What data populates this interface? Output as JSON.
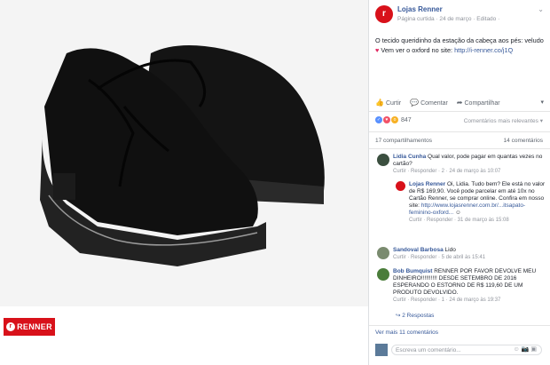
{
  "brand_color": "#d8111a",
  "link_color": "#365899",
  "photo": {
    "logo_text": "RENNER"
  },
  "post": {
    "page_name": "Lojas Renner",
    "meta": "Página curtida · 24 de março · Editado ·",
    "text_1": "O tecido queridinho da estação da cabeça aos pés: veludo ",
    "text_2": " Vem ver o oxford no site: ",
    "link": "http://i-renner.co/j1Q",
    "actions": {
      "like": "Curtir",
      "comment": "Comentar",
      "share": "Compartilhar"
    },
    "reaction_count": "847",
    "relevance": "Comentários mais relevantes",
    "shares": "17 compartilhamentos",
    "comments_count": "14 comentários"
  },
  "comments": [
    {
      "name": "Lidia Cunha",
      "text": "Qual valor, pode pagar em quantas vezes no cartão?",
      "meta": "Curtir · Responder · 2 · 24 de março às 10:07"
    },
    {
      "name": "Lojas Renner",
      "text": "Oi, Lidia. Tudo bem? Ele está no valor de R$ 169,90. Você pode parcelar em até 10x no Cartão Renner, se comprar online. Confira em nosso site: ",
      "link": "http://www.lojasrenner.com.br/...itsapato-feminino-oxford...",
      "meta": "Curtir · Responder · 31 de março às 15:08"
    },
    {
      "name": "Sandoval Barbosa",
      "text": "Lido",
      "meta": "Curtir · Responder · 5 de abril às 15:41"
    },
    {
      "name": "Bob Bumquist",
      "text": "RENNER POR FAVOR DEVOLVE MEU DINHEIRO!!!!!!!!!! DESDE SETEMBRO DE 2016 ESPERANDO O ESTORNO DE R$ 119,60 DE UM PRODUTO DEVOLVIDO.",
      "meta": "Curtir · Responder · 1 · 24 de março às 19:37"
    }
  ],
  "replies_link": "2 Respostas",
  "more_comments": "Ver mais 11 comentários",
  "composer_placeholder": "Escreva um comentário..."
}
